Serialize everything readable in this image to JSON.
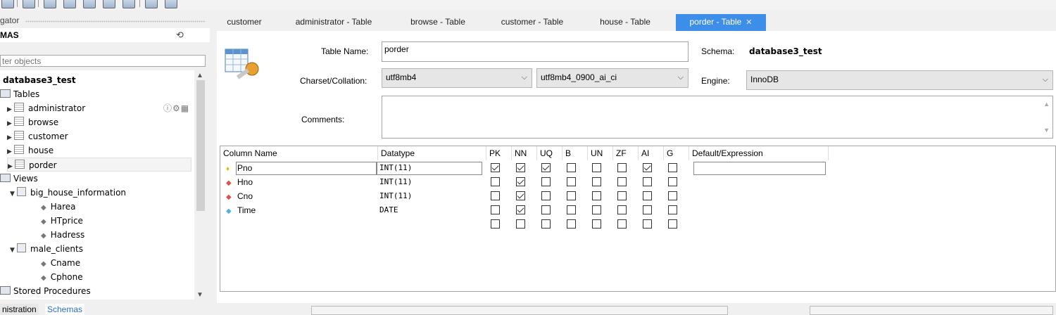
{
  "navigator": {
    "title": "gator",
    "schemas_label": "MAS",
    "filter_placeholder": "ter objects",
    "tree": {
      "schema": "database3_test",
      "tables_label": "Tables",
      "tables": [
        "administrator",
        "browse",
        "customer",
        "house",
        "porder"
      ],
      "views_label": "Views",
      "views": [
        {
          "name": "big_house_information",
          "columns": [
            "Harea",
            "HTprice",
            "Hadress"
          ]
        },
        {
          "name": "male_clients",
          "columns": [
            "Cname",
            "Cphone"
          ]
        }
      ],
      "procedures_label": "Stored Procedures"
    },
    "bottom_tabs": [
      "nistration",
      "Schemas"
    ]
  },
  "editor": {
    "tabs": [
      "customer",
      "administrator - Table",
      "browse - Table",
      "customer - Table",
      "house - Table",
      "porder - Table"
    ],
    "active_tab": "porder - Table",
    "table_name_label": "Table Name:",
    "table_name": "porder",
    "schema_label": "Schema:",
    "schema": "database3_test",
    "charset_label": "Charset/Collation:",
    "charset": "utf8mb4",
    "collation": "utf8mb4_0900_ai_ci",
    "engine_label": "Engine:",
    "engine": "InnoDB",
    "comments_label": "Comments:",
    "comments": "",
    "grid": {
      "headers": [
        "Column Name",
        "Datatype",
        "PK",
        "NN",
        "UQ",
        "B",
        "UN",
        "ZF",
        "AI",
        "G",
        "Default/Expression"
      ],
      "rows": [
        {
          "name": "Pno",
          "type": "INT(11)",
          "key": "primary",
          "flags": [
            true,
            true,
            true,
            false,
            false,
            false,
            true,
            false
          ]
        },
        {
          "name": "Hno",
          "type": "INT(11)",
          "key": "foreign",
          "flags": [
            false,
            true,
            false,
            false,
            false,
            false,
            false,
            false
          ]
        },
        {
          "name": "Cno",
          "type": "INT(11)",
          "key": "foreign",
          "flags": [
            false,
            true,
            false,
            false,
            false,
            false,
            false,
            false
          ]
        },
        {
          "name": "Time",
          "type": "DATE",
          "key": "column",
          "flags": [
            false,
            true,
            false,
            false,
            false,
            false,
            false,
            false
          ]
        },
        {
          "name": "",
          "type": "",
          "key": "none",
          "flags": [
            false,
            false,
            false,
            false,
            false,
            false,
            false,
            false
          ]
        }
      ]
    }
  },
  "colors": {
    "accent": "#3c8ee8",
    "primary_key": "#e6b800",
    "foreign_key": "#d9534f",
    "column": "#4fb3d9"
  }
}
